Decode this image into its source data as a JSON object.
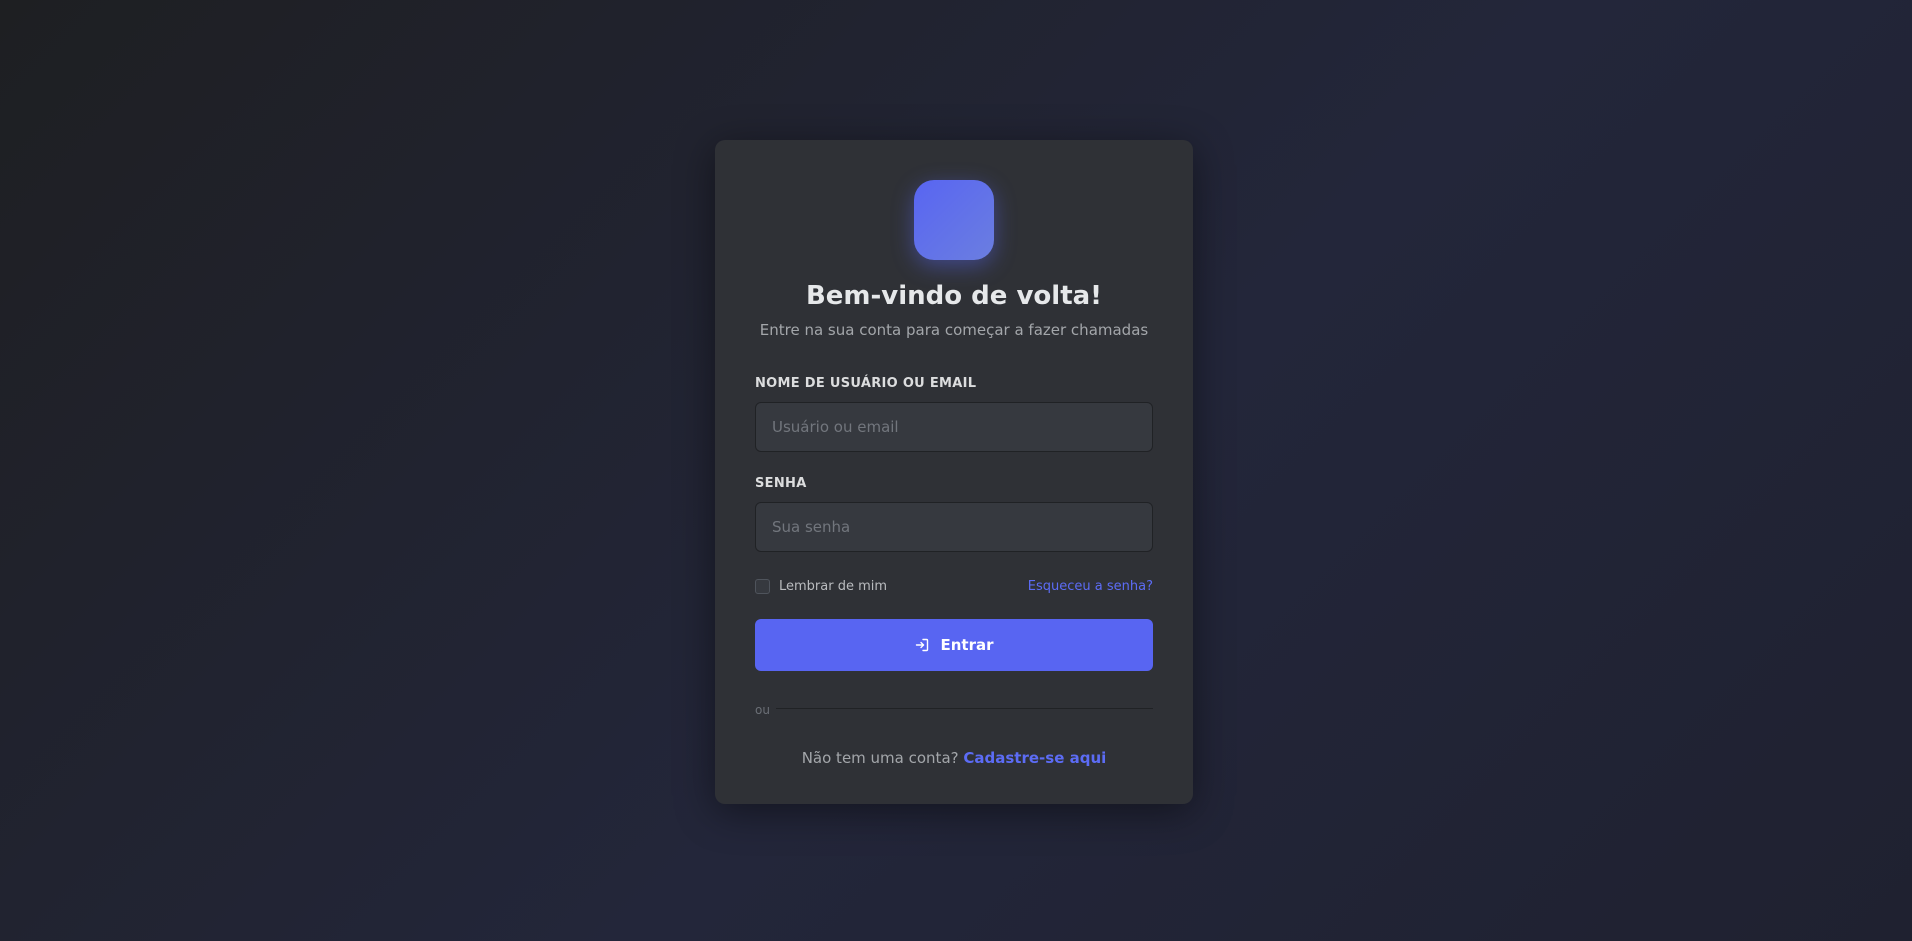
{
  "header": {
    "title": "Bem-vindo de volta!",
    "subtitle": "Entre na sua conta para começar a fazer chamadas"
  },
  "form": {
    "username": {
      "label": "NOME DE USUÁRIO OU EMAIL",
      "placeholder": "Usuário ou email",
      "value": ""
    },
    "password": {
      "label": "SENHA",
      "placeholder": "Sua senha",
      "value": ""
    },
    "remember_label": "Lembrar de mim",
    "remember_checked": false,
    "forgot_label": "Esqueceu a senha?",
    "submit_label": "Entrar",
    "submit_icon": "login-icon"
  },
  "divider_text": "ou",
  "footer": {
    "prompt": "Não tem uma conta?",
    "link_label": "Cadastre-se aqui"
  },
  "colors": {
    "accent": "#5865f2",
    "link": "#5c6cf5",
    "card_bg": "#2f3136",
    "input_bg": "#36393f"
  }
}
